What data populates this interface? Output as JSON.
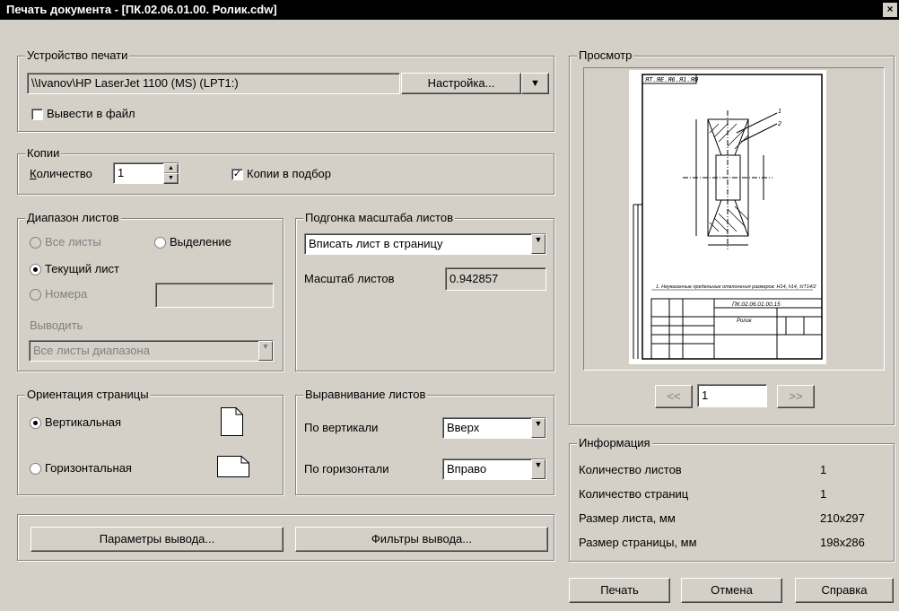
{
  "window": {
    "title": "Печать документа - [ПК.02.06.01.00. Ролик.cdw]",
    "close": "×"
  },
  "device": {
    "legend": "Устройство печати",
    "printer": "\\\\Ivanov\\HP LaserJet 1100 (MS) (LPT1:)",
    "setup_label": "Настройка...",
    "dropdown": "▼",
    "to_file_label": "Вывести в файл",
    "to_file_checked": false
  },
  "copies": {
    "legend": "Копии",
    "count_label": "Количество",
    "count_value": "1",
    "collate_label": "Копии в подбор",
    "collate_checked": true
  },
  "range": {
    "legend": "Диапазон листов",
    "all_label": "Все листы",
    "selection_label": "Выделение",
    "current_label": "Текущий лист",
    "numbers_label": "Номера",
    "output_label": "Выводить",
    "output_value": "Все листы диапазона",
    "selected": "current"
  },
  "scale": {
    "legend": "Подгонка масштаба листов",
    "fit_value": "Вписать лист в страницу",
    "scale_label": "Масштаб листов",
    "scale_value": "0.942857"
  },
  "orientation": {
    "legend": "Ориентация страницы",
    "portrait_label": "Вертикальная",
    "landscape_label": "Горизонтальная",
    "selected": "portrait"
  },
  "align": {
    "legend": "Выравнивание листов",
    "vertical_label": "По вертикали",
    "vertical_value": "Вверх",
    "horizontal_label": "По горизонтали",
    "horizontal_value": "Вправо"
  },
  "buttons": {
    "params": "Параметры вывода...",
    "filters": "Фильтры вывода...",
    "print": "Печать",
    "cancel": "Отмена",
    "help": "Справка"
  },
  "preview": {
    "legend": "Просмотр",
    "prev": "<<",
    "next": ">>",
    "page": "1",
    "sheet_code_top": "ЯТ.ЯЕ.Я6.Я1.ЯЯ",
    "title_code": "ПК.02.06.01.00.15",
    "title_name": "Ролик",
    "note": "1. Неуказанные предельные отклонения размеров: H14, h14, ±IT14/2"
  },
  "info": {
    "legend": "Информация",
    "rows": [
      {
        "label": "Количество листов",
        "value": "1"
      },
      {
        "label": "Количество страниц",
        "value": "1"
      },
      {
        "label": "Размер листа, мм",
        "value": "210x297"
      },
      {
        "label": "Размер страницы, мм",
        "value": "198x286"
      }
    ]
  }
}
